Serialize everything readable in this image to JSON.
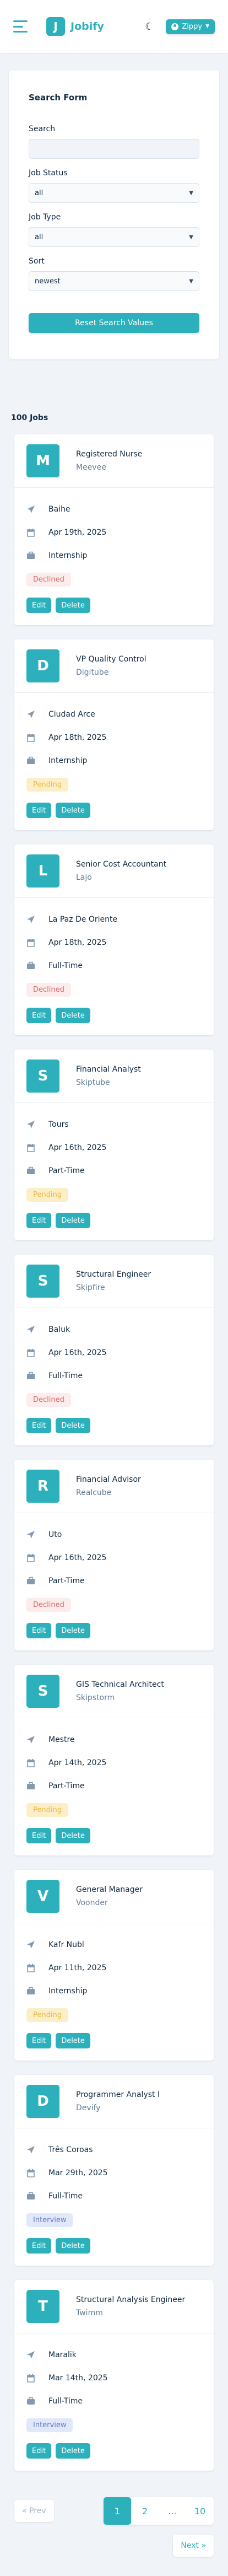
{
  "navbar": {
    "logo_letter": "J",
    "logo_text": "Jobify",
    "theme_icon": "moon-icon",
    "user_name": "Zippy",
    "caret": "▼"
  },
  "search_form": {
    "title": "Search Form",
    "search_label": "Search",
    "search_value": "",
    "status_label": "Job Status",
    "status_value": "all",
    "type_label": "Job Type",
    "type_value": "all",
    "sort_label": "Sort",
    "sort_value": "newest",
    "reset_label": "Reset Search Values"
  },
  "jobs": {
    "count_label": "100 Jobs",
    "edit_label": "Edit",
    "delete_label": "Delete",
    "items": [
      {
        "letter": "M",
        "title": "Registered Nurse",
        "company": "Meevee",
        "location": "Baihe",
        "date": "Apr 19th, 2025",
        "type": "Internship",
        "status": "Declined",
        "status_class": "declined"
      },
      {
        "letter": "D",
        "title": "VP Quality Control",
        "company": "Digitube",
        "location": "Ciudad Arce",
        "date": "Apr 18th, 2025",
        "type": "Internship",
        "status": "Pending",
        "status_class": "pending"
      },
      {
        "letter": "L",
        "title": "Senior Cost Accountant",
        "company": "Lajo",
        "location": "La Paz De Oriente",
        "date": "Apr 18th, 2025",
        "type": "Full-Time",
        "status": "Declined",
        "status_class": "declined"
      },
      {
        "letter": "S",
        "title": "Financial Analyst",
        "company": "Skiptube",
        "location": "Tours",
        "date": "Apr 16th, 2025",
        "type": "Part-Time",
        "status": "Pending",
        "status_class": "pending"
      },
      {
        "letter": "S",
        "title": "Structural Engineer",
        "company": "Skipfire",
        "location": "Baluk",
        "date": "Apr 16th, 2025",
        "type": "Full-Time",
        "status": "Declined",
        "status_class": "declined"
      },
      {
        "letter": "R",
        "title": "Financial Advisor",
        "company": "Realcube",
        "location": "Uto",
        "date": "Apr 16th, 2025",
        "type": "Part-Time",
        "status": "Declined",
        "status_class": "declined"
      },
      {
        "letter": "S",
        "title": "GIS Technical Architect",
        "company": "Skipstorm",
        "location": "Mestre",
        "date": "Apr 14th, 2025",
        "type": "Part-Time",
        "status": "Pending",
        "status_class": "pending"
      },
      {
        "letter": "V",
        "title": "General Manager",
        "company": "Voonder",
        "location": "Kafr Nubl",
        "date": "Apr 11th, 2025",
        "type": "Internship",
        "status": "Pending",
        "status_class": "pending"
      },
      {
        "letter": "D",
        "title": "Programmer Analyst I",
        "company": "Devify",
        "location": "Três Coroas",
        "date": "Mar 29th, 2025",
        "type": "Full-Time",
        "status": "Interview",
        "status_class": "interview"
      },
      {
        "letter": "T",
        "title": "Structural Analysis Engineer",
        "company": "Twimm",
        "location": "Maralik",
        "date": "Mar 14th, 2025",
        "type": "Full-Time",
        "status": "Interview",
        "status_class": "interview"
      }
    ]
  },
  "pagination": {
    "prev_label": "« Prev",
    "next_label": "Next »",
    "pages": [
      "1",
      "2",
      "...",
      "10"
    ],
    "active_page": "1"
  },
  "colors": {
    "primary": "#2cb1bc",
    "background": "#f0f4f8"
  }
}
